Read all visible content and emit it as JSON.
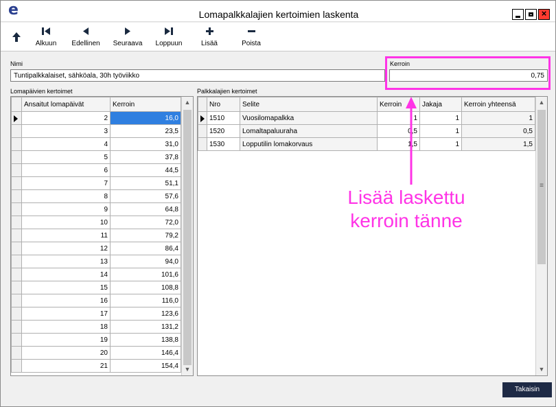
{
  "window": {
    "title": "Lomapalkkalajien kertoimien laskenta",
    "app_logo": "e"
  },
  "toolbar": {
    "buttons": [
      {
        "label": "Alkuun",
        "icon": "first-icon"
      },
      {
        "label": "Edellinen",
        "icon": "previous-icon"
      },
      {
        "label": "Seuraava",
        "icon": "next-icon"
      },
      {
        "label": "Loppuun",
        "icon": "last-icon"
      },
      {
        "label": "Lisää",
        "icon": "plus-icon"
      },
      {
        "label": "Poista",
        "icon": "minus-icon"
      }
    ]
  },
  "nimi": {
    "label": "Nimi",
    "value": "Tuntipalkkalaiset, sähköala, 30h työviikko"
  },
  "kerroin": {
    "label": "Kerroin",
    "value": "0,75"
  },
  "lomapaivat": {
    "label": "Lomapäivien kertoimet",
    "columns": [
      "Ansaitut lomapäivät",
      "Kerroin"
    ],
    "rows": [
      [
        "2",
        "16,0"
      ],
      [
        "3",
        "23,5"
      ],
      [
        "4",
        "31,0"
      ],
      [
        "5",
        "37,8"
      ],
      [
        "6",
        "44,5"
      ],
      [
        "7",
        "51,1"
      ],
      [
        "8",
        "57,6"
      ],
      [
        "9",
        "64,8"
      ],
      [
        "10",
        "72,0"
      ],
      [
        "11",
        "79,2"
      ],
      [
        "12",
        "86,4"
      ],
      [
        "13",
        "94,0"
      ],
      [
        "14",
        "101,6"
      ],
      [
        "15",
        "108,8"
      ],
      [
        "16",
        "116,0"
      ],
      [
        "17",
        "123,6"
      ],
      [
        "18",
        "131,2"
      ],
      [
        "19",
        "138,8"
      ],
      [
        "20",
        "146,4"
      ],
      [
        "21",
        "154,4"
      ]
    ]
  },
  "palkkalajit": {
    "label": "Palkkalajien kertoimet",
    "columns": [
      "Nro",
      "Selite",
      "Kerroin",
      "Jakaja",
      "Kerroin yhteensä"
    ],
    "rows": [
      [
        "1510",
        "Vuosilomapalkka",
        "1",
        "1",
        "1"
      ],
      [
        "1520",
        "Lomaltapaluuraha",
        "0,5",
        "1",
        "0,5"
      ],
      [
        "1530",
        "Lopputilin lomakorvaus",
        "1,5",
        "1",
        "1,5"
      ]
    ]
  },
  "annotation": {
    "text": "Lisää laskettu kerroin tänne",
    "color": "#ff33e6"
  },
  "footer": {
    "back_label": "Takaisin"
  },
  "colors": {
    "selection": "#2f7fe0",
    "back_button": "#1e2a45",
    "close_button": "#ff3b30"
  }
}
